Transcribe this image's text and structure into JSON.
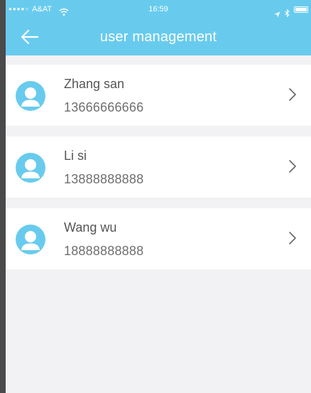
{
  "status_bar": {
    "carrier": "A&AT",
    "time": "16:59"
  },
  "header": {
    "title": "user management"
  },
  "users": [
    {
      "name": "Zhang san",
      "phone": "13666666666"
    },
    {
      "name": "Li si",
      "phone": "13888888888"
    },
    {
      "name": "Wang wu",
      "phone": "18888888888"
    }
  ],
  "colors": {
    "accent": "#68cbee",
    "background": "#f2f2f4",
    "text_primary": "#555555",
    "text_secondary": "#6f6f6f"
  },
  "icons": {
    "back": "arrow-left-icon",
    "avatar": "person-icon",
    "row_action": "chevron-right-icon",
    "wifi": "wifi-icon",
    "location": "location-arrow-icon",
    "bluetooth": "bluetooth-icon",
    "battery": "battery-icon"
  }
}
